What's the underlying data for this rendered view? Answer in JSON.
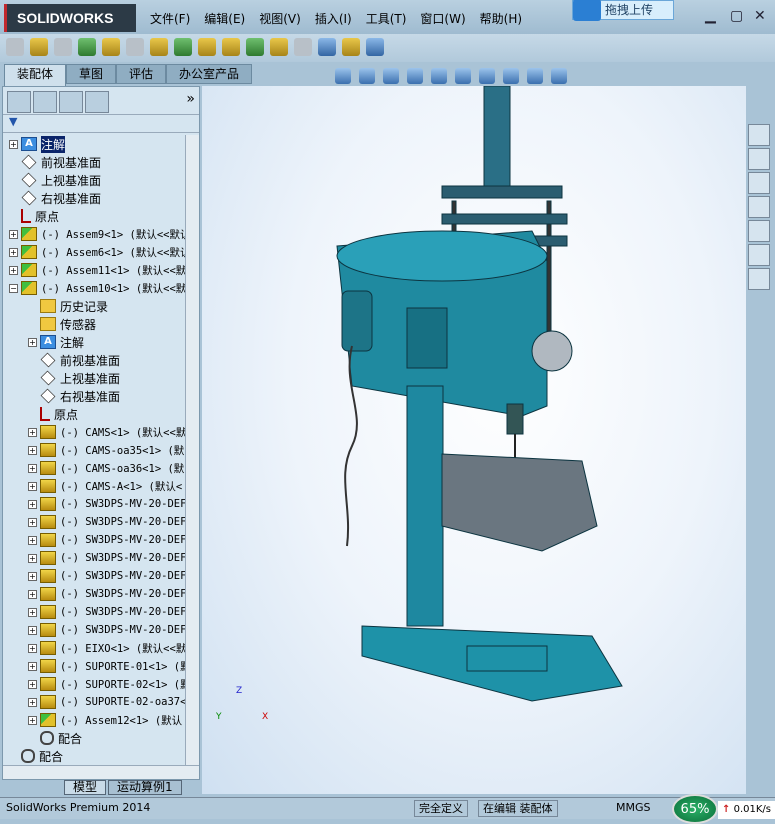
{
  "app": {
    "logo": "SOLIDWORKS",
    "menu": [
      "文件(F)",
      "编辑(E)",
      "视图(V)",
      "插入(I)",
      "工具(T)",
      "窗口(W)",
      "帮助(H)"
    ],
    "upload_label": "拖拽上传"
  },
  "command_tabs": [
    "装配体",
    "草图",
    "评估",
    "办公室产品"
  ],
  "panel": {
    "more": "»",
    "filter": "▼"
  },
  "tree": [
    {
      "label": "注解",
      "icon": "annot",
      "level": 0,
      "exp": "+",
      "sel": true
    },
    {
      "label": "前视基准面",
      "icon": "plane",
      "level": 0
    },
    {
      "label": "上视基准面",
      "icon": "plane",
      "level": 0
    },
    {
      "label": "右视基准面",
      "icon": "plane",
      "level": 0
    },
    {
      "label": "原点",
      "icon": "origin",
      "level": 0
    },
    {
      "label": "(-) Assem9<1> (默认<<默认",
      "icon": "asm",
      "level": 0,
      "exp": "+",
      "mono": true
    },
    {
      "label": "(-) Assem6<1> (默认<<默认",
      "icon": "asm",
      "level": 0,
      "exp": "+",
      "mono": true
    },
    {
      "label": "(-) Assem11<1> (默认<<默",
      "icon": "asm",
      "level": 0,
      "exp": "+",
      "mono": true
    },
    {
      "label": "(-) Assem10<1> (默认<<默",
      "icon": "asm",
      "level": 0,
      "exp": "−",
      "mono": true
    },
    {
      "label": "历史记录",
      "icon": "folder",
      "level": 1
    },
    {
      "label": "传感器",
      "icon": "folder",
      "level": 1
    },
    {
      "label": "注解",
      "icon": "annot",
      "level": 1,
      "exp": "+"
    },
    {
      "label": "前视基准面",
      "icon": "plane",
      "level": 1
    },
    {
      "label": "上视基准面",
      "icon": "plane",
      "level": 1
    },
    {
      "label": "右视基准面",
      "icon": "plane",
      "level": 1
    },
    {
      "label": "原点",
      "icon": "origin",
      "level": 1
    },
    {
      "label": "(-) CAMS<1> (默认<<默",
      "icon": "part",
      "level": 1,
      "exp": "+",
      "mono": true
    },
    {
      "label": "(-) CAMS-oa35<1> (默",
      "icon": "part",
      "level": 1,
      "exp": "+",
      "mono": true
    },
    {
      "label": "(-) CAMS-oa36<1> (默",
      "icon": "part",
      "level": 1,
      "exp": "+",
      "mono": true
    },
    {
      "label": "(-) CAMS-A<1> (默认<",
      "icon": "part",
      "level": 1,
      "exp": "+",
      "mono": true
    },
    {
      "label": "(-) SW3DPS-MV-20-DEF.",
      "icon": "part",
      "level": 1,
      "exp": "+",
      "mono": true
    },
    {
      "label": "(-) SW3DPS-MV-20-DEF.",
      "icon": "part",
      "level": 1,
      "exp": "+",
      "mono": true
    },
    {
      "label": "(-) SW3DPS-MV-20-DEF.",
      "icon": "part",
      "level": 1,
      "exp": "+",
      "mono": true
    },
    {
      "label": "(-) SW3DPS-MV-20-DEF.",
      "icon": "part",
      "level": 1,
      "exp": "+",
      "mono": true
    },
    {
      "label": "(-) SW3DPS-MV-20-DEF.",
      "icon": "part",
      "level": 1,
      "exp": "+",
      "mono": true
    },
    {
      "label": "(-) SW3DPS-MV-20-DEF.",
      "icon": "part",
      "level": 1,
      "exp": "+",
      "mono": true
    },
    {
      "label": "(-) SW3DPS-MV-20-DEF.",
      "icon": "part",
      "level": 1,
      "exp": "+",
      "mono": true
    },
    {
      "label": "(-) SW3DPS-MV-20-DEF.",
      "icon": "part",
      "level": 1,
      "exp": "+",
      "mono": true
    },
    {
      "label": "(-) EIXO<1> (默认<<默",
      "icon": "part",
      "level": 1,
      "exp": "+",
      "mono": true
    },
    {
      "label": "(-) SUPORTE-01<1> (默",
      "icon": "part",
      "level": 1,
      "exp": "+",
      "mono": true
    },
    {
      "label": "(-) SUPORTE-02<1> (默",
      "icon": "part",
      "level": 1,
      "exp": "+",
      "mono": true
    },
    {
      "label": "(-) SUPORTE-02-oa37<",
      "icon": "part",
      "level": 1,
      "exp": "+",
      "mono": true
    },
    {
      "label": "(-) Assem12<1> (默认",
      "icon": "asm",
      "level": 1,
      "exp": "+",
      "mono": true
    },
    {
      "label": "配合",
      "icon": "mate",
      "level": 1
    },
    {
      "label": "配合",
      "icon": "mate",
      "level": 0
    }
  ],
  "bottom_tabs": [
    "模型",
    "运动算例1"
  ],
  "status": {
    "product": "SolidWorks Premium 2014",
    "defined": "完全定义",
    "editing": "在编辑 装配体",
    "units": "MMGS"
  },
  "network": {
    "percent": "65%",
    "speed": "0.01K/s"
  },
  "triad": {
    "x": "X",
    "y": "Y",
    "z": "Z"
  }
}
